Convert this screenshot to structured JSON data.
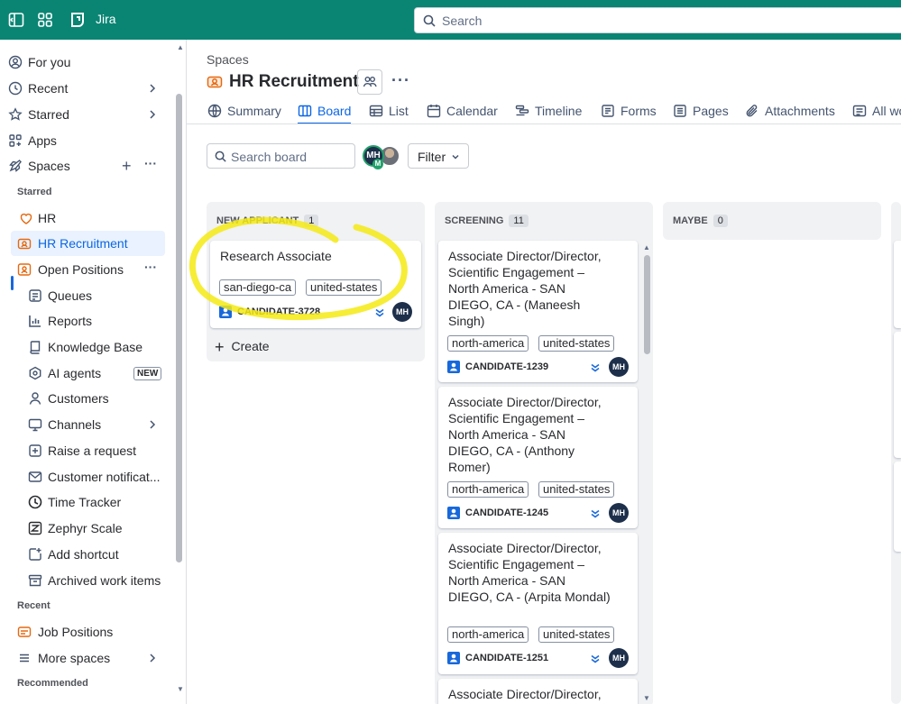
{
  "app": {
    "name": "Jira",
    "search_placeholder": "Search",
    "brand_color": "#0a8574"
  },
  "sidebar": {
    "top_items": [
      {
        "label": "For you",
        "icon": "user-circle-icon"
      },
      {
        "label": "Recent",
        "icon": "clock-icon"
      },
      {
        "label": "Starred",
        "icon": "star-icon"
      },
      {
        "label": "Apps",
        "icon": "apps-icon"
      },
      {
        "label": "Spaces",
        "icon": "rocket-icon"
      }
    ],
    "sections": {
      "starred": "Starred",
      "recent": "Recent",
      "recommended": "Recommended"
    },
    "starred_items": [
      {
        "label": "HR",
        "icon": "hr-space-icon"
      },
      {
        "label": "HR Recruitment",
        "icon": "recruitment-space-icon",
        "active": true
      },
      {
        "label": "Open Positions",
        "icon": "positions-space-icon"
      }
    ],
    "sub_items": [
      {
        "label": "Queues",
        "icon": "queue-icon"
      },
      {
        "label": "Reports",
        "icon": "chart-icon"
      },
      {
        "label": "Knowledge Base",
        "icon": "book-icon"
      },
      {
        "label": "AI agents",
        "icon": "ai-agent-icon",
        "badge": "NEW"
      },
      {
        "label": "Customers",
        "icon": "person-icon"
      },
      {
        "label": "Channels",
        "icon": "monitor-icon"
      },
      {
        "label": "Raise a request",
        "icon": "plus-square-icon"
      },
      {
        "label": "Customer notificat...",
        "icon": "mail-icon"
      },
      {
        "label": "Time Tracker",
        "icon": "stopwatch-icon"
      },
      {
        "label": "Zephyr Scale",
        "icon": "zephyr-icon"
      },
      {
        "label": "Add shortcut",
        "icon": "add-shortcut-icon"
      },
      {
        "label": "Archived work items",
        "icon": "archive-icon"
      }
    ],
    "recent_items": [
      {
        "label": "Job Positions",
        "icon": "job-positions-icon"
      },
      {
        "label": "More spaces",
        "icon": "more-spaces-icon"
      }
    ]
  },
  "page": {
    "breadcrumb": "Spaces",
    "title": "HR Recruitment",
    "more": "···"
  },
  "tabs": [
    {
      "label": "Summary",
      "icon": "globe-icon"
    },
    {
      "label": "Board",
      "icon": "board-icon",
      "active": true
    },
    {
      "label": "List",
      "icon": "list-icon"
    },
    {
      "label": "Calendar",
      "icon": "calendar-icon"
    },
    {
      "label": "Timeline",
      "icon": "timeline-icon"
    },
    {
      "label": "Forms",
      "icon": "forms-icon"
    },
    {
      "label": "Pages",
      "icon": "pages-icon"
    },
    {
      "label": "Attachments",
      "icon": "paperclip-icon"
    },
    {
      "label": "All wo",
      "icon": "all-work-icon"
    }
  ],
  "toolbar": {
    "search_placeholder": "Search board",
    "avatar_initials": "MH",
    "avatar_mini": "M",
    "filter_label": "Filter"
  },
  "board": {
    "columns": [
      {
        "name": "NEW APPLICANT",
        "count": "1",
        "create_label": "Create",
        "cards": [
          {
            "title": "Research Associate",
            "tags": [
              "san-diego-ca",
              "united-states"
            ],
            "key": "CANDIDATE-3728",
            "assignee": "MH"
          }
        ]
      },
      {
        "name": "SCREENING",
        "count": "11",
        "cards": [
          {
            "title": "Associate Director/Director, Scientific Engagement – North America - SAN DIEGO, CA - (Maneesh Singh)",
            "tags": [
              "north-america",
              "united-states"
            ],
            "key": "CANDIDATE-1239",
            "assignee": "MH"
          },
          {
            "title": "Associate Director/Director, Scientific Engagement – North America - SAN DIEGO, CA - (Anthony Romer)",
            "tags": [
              "north-america",
              "united-states"
            ],
            "key": "CANDIDATE-1245",
            "assignee": "MH"
          },
          {
            "title": "Associate Director/Director, Scientific Engagement – North America - SAN DIEGO, CA - (Arpita Mondal)",
            "tags": [
              "north-america",
              "united-states"
            ],
            "key": "CANDIDATE-1251",
            "assignee": "MH"
          },
          {
            "title": "Associate Director/Director,",
            "tags": [],
            "key": "",
            "assignee": ""
          }
        ]
      },
      {
        "name": "MAYBE",
        "count": "0",
        "cards": []
      }
    ]
  },
  "annotation": {
    "color": "#f5ea14"
  }
}
